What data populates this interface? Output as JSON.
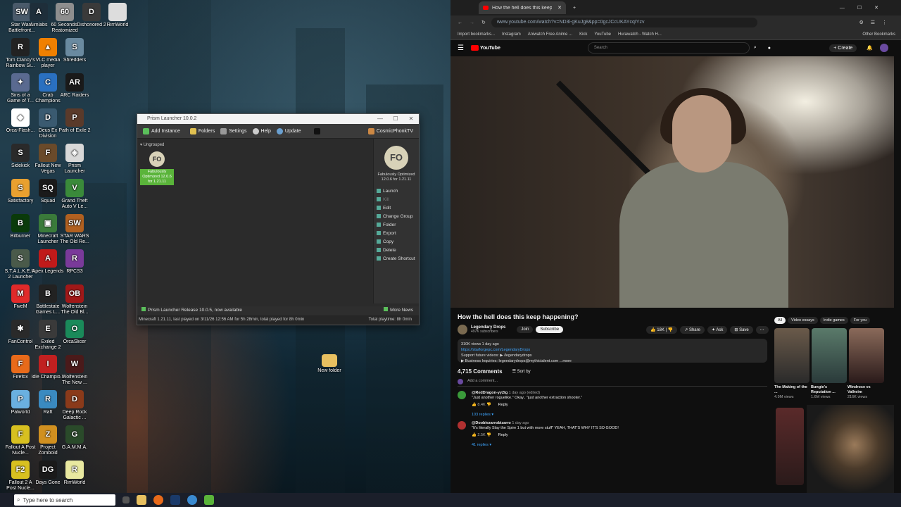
{
  "desktop": {
    "icons": [
      {
        "label": "Star Wars Battlefront...",
        "color": "#4a5a6a",
        "glyph": "SW"
      },
      {
        "label": "Aimlabs",
        "color": "#1e2e3a",
        "glyph": "A"
      },
      {
        "label": "60 Seconds! Reatomized",
        "color": "#8e8e8e",
        "glyph": "60"
      },
      {
        "label": "Dishonored 2",
        "color": "#3a3a3a",
        "glyph": "D"
      },
      {
        "label": "RimWorld",
        "color": "#dddddd",
        "glyph": ""
      },
      {
        "label": "Tom Clancy's Rainbow Si...",
        "color": "#222222",
        "glyph": "R"
      },
      {
        "label": "VLC media player",
        "color": "#f08000",
        "glyph": "▲"
      },
      {
        "label": "Shredders",
        "color": "#6a8aa0",
        "glyph": "S"
      },
      {
        "label": "Sins of a Game of T...",
        "color": "#5a6a90",
        "glyph": "✦"
      },
      {
        "label": "Crab Champions",
        "color": "#2a70c0",
        "glyph": "C"
      },
      {
        "label": "ARC Raiders",
        "color": "#1a1a1a",
        "glyph": "AR"
      },
      {
        "label": "Orca-Flash...",
        "color": "#ffffff",
        "glyph": "◆"
      },
      {
        "label": "Deus Ex Division",
        "color": "#3a5a70",
        "glyph": "D"
      },
      {
        "label": "Path of Exile 2",
        "color": "#5a3a2a",
        "glyph": "P"
      },
      {
        "label": "Sidekick",
        "color": "#2a2a2a",
        "glyph": "S"
      },
      {
        "label": "Fallout New Vegas",
        "color": "#6a4a2a",
        "glyph": "F"
      },
      {
        "label": "Prism Launcher",
        "color": "#d8d8d8",
        "glyph": "◈"
      },
      {
        "label": "Satisfactory",
        "color": "#e8a030",
        "glyph": "S"
      },
      {
        "label": "Squad",
        "color": "#1a1a1a",
        "glyph": "SQ"
      },
      {
        "label": "Grand Theft Auto V Le...",
        "color": "#3a8a3a",
        "glyph": "V"
      },
      {
        "label": "Bitburner",
        "color": "#0a3a0a",
        "glyph": "B"
      },
      {
        "label": "Minecraft Launcher",
        "color": "#3a7a3a",
        "glyph": "▣"
      },
      {
        "label": "STAR WARS The Old Re...",
        "color": "#b06020",
        "glyph": "SW"
      },
      {
        "label": "S.T.A.L.K.E.R. 2 Launcher",
        "color": "#4a5a4a",
        "glyph": "S"
      },
      {
        "label": "Apex Legends",
        "color": "#c01a1a",
        "glyph": "A"
      },
      {
        "label": "RPCS3",
        "color": "#7a3a9a",
        "glyph": "R"
      },
      {
        "label": "FiveM",
        "color": "#e02a2a",
        "glyph": "M"
      },
      {
        "label": "Battlestate Games L...",
        "color": "#222222",
        "glyph": "B"
      },
      {
        "label": "Wolfenstein The Old Bl...",
        "color": "#a01818",
        "glyph": "OB"
      },
      {
        "label": "FanControl",
        "color": "#2a2a2a",
        "glyph": "✱"
      },
      {
        "label": "Exiled Exchange 2",
        "color": "#3a3a3a",
        "glyph": "E"
      },
      {
        "label": "OrcaSlicer",
        "color": "#1a8a5a",
        "glyph": "O"
      },
      {
        "label": "Firefox",
        "color": "#e86a1a",
        "glyph": "F"
      },
      {
        "label": "Idle Champio...",
        "color": "#c02020",
        "glyph": "I"
      },
      {
        "label": "Wolfenstein The New ...",
        "color": "#4a1a1a",
        "glyph": "W"
      },
      {
        "label": "Palworld",
        "color": "#6ab0e0",
        "glyph": "P"
      },
      {
        "label": "Raft",
        "color": "#3a8ac0",
        "glyph": "R"
      },
      {
        "label": "Deep Rock Galactic ...",
        "color": "#8a3a1a",
        "glyph": "D"
      },
      {
        "label": "Fallout A Post Nucle...",
        "color": "#d8c020",
        "glyph": "F"
      },
      {
        "label": "Project Zomboid",
        "color": "#d09020",
        "glyph": "Z"
      },
      {
        "label": "G.A.M.M.A.",
        "color": "#2a4a2a",
        "glyph": "G"
      },
      {
        "label": "Fallout 2 A Post Nucle...",
        "color": "#d8c020",
        "glyph": "F2"
      },
      {
        "label": "Days Gone",
        "color": "#1a1a1a",
        "glyph": "DG"
      },
      {
        "label": "RimWorld",
        "color": "#e8e8a0",
        "glyph": "R"
      }
    ],
    "new_folder_label": "New folder"
  },
  "prism": {
    "title": "Prism Launcher 10.0.2",
    "toolbar": {
      "add_instance": "Add Instance",
      "folders": "Folders",
      "settings": "Settings",
      "help": "Help",
      "update": "Update",
      "account": "CosmicPhonkTV"
    },
    "group_label": "Ungrouped",
    "instance": {
      "initials": "FO",
      "label": "Fabulously Optimized 12.0.6 for 1.21.11"
    },
    "side": {
      "name": "Fabulously Optimized 12.0.6 for 1.21.11",
      "actions": [
        "Launch",
        "Kill",
        "Edit",
        "Change Group",
        "Folder",
        "Export",
        "Copy",
        "Delete",
        "Create Shortcut"
      ]
    },
    "news": "Prism Launcher Release 10.0.5, now available",
    "more_news": "More News",
    "status": "Minecraft 1.21.11, last played on 3/11/26 12:56 AM for 5h 28min, total played for 8h 0min",
    "total_playtime": "Total playtime: 8h 0min"
  },
  "taskbar": {
    "search_placeholder": "Type here to search"
  },
  "browser": {
    "tab_title": "How the hell does this keep",
    "url": "www.youtube.com/watch?v=ND3i-gKuJg8&pp=0gcJCcUKAYcqIYzv",
    "bookmarks": [
      "Import bookmarks...",
      "Instagram",
      "Aniwatch Free Anime ...",
      "Kick",
      "YouTube",
      "Hurawatch - Watch H..."
    ],
    "other_bookmarks": "Other Bookmarks",
    "yt_logo": "YouTube",
    "search_placeholder": "Search",
    "create_label": "Create",
    "video_title": "How the hell does this keep happening?",
    "channel": "Legendary Drops",
    "subs": "497K subscribers",
    "join": "Join",
    "subscribe": "Subscribe",
    "likes": "18K",
    "share": "Share",
    "ask": "Ask",
    "save": "Save",
    "views_line": "310K views  1 day ago",
    "desc_line1": "https://starforgepc.com/LegendaryDrops",
    "desc_line2": "Support future videos: ▶ /legendarydrops",
    "desc_line3": "▶ Business Inquiries: legendarydrops@mythictalent.com  ...more",
    "comments_count": "4,715 Comments",
    "sort_by": "Sort by",
    "add_comment": "Add a comment...",
    "comments": [
      {
        "author": "@RedDragon-yy2tg",
        "meta": "1 day ago (edited)",
        "text": "\"Just another roguelike.\" Okay.. \"just another extraction shooter.\"",
        "likes": "8.4K",
        "replies": "103 replies",
        "color": "#3a9a3a"
      },
      {
        "author": "@Doobiezarrobizarro",
        "meta": "1 day ago",
        "text": "\"It's literally Slay the Spire 1 but with more stuff\" YEAH, THAT'S WHY IT'S SO GOOD!",
        "likes": "2.5K",
        "replies": "41 replies",
        "color": "#b03030"
      }
    ],
    "reply_label": "Reply",
    "chips": [
      "All",
      "Video essays",
      "Indie games",
      "For you"
    ],
    "recs": [
      {
        "title": "The Making of the ...",
        "views": "4.9M views"
      },
      {
        "title": "Bungie's Reputation ...",
        "views": "1.6M views"
      },
      {
        "title": "Windrose vs Valheim",
        "views": "216K views"
      }
    ]
  }
}
